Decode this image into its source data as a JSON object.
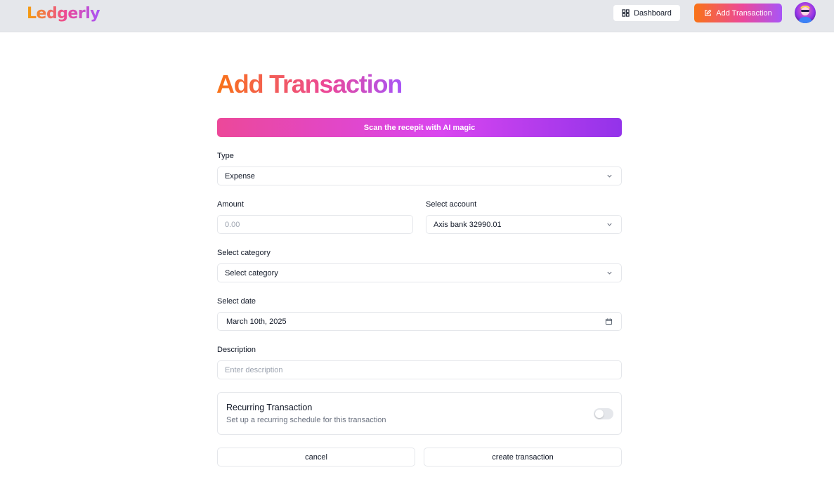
{
  "header": {
    "logo": "Ledgerly",
    "dashboard_label": "Dashboard",
    "add_transaction_label": "Add Transaction"
  },
  "main": {
    "title": "Add Transaction",
    "scan_label": "Scan the recepit with AI magic",
    "type": {
      "label": "Type",
      "value": "Expense"
    },
    "amount": {
      "label": "Amount",
      "placeholder": "0.00"
    },
    "account": {
      "label": "Select account",
      "value": "Axis bank 32990.01"
    },
    "category": {
      "label": "Select category",
      "value": "Select category"
    },
    "date": {
      "label": "Select date",
      "value": "March 10th, 2025"
    },
    "description": {
      "label": "Description",
      "placeholder": "Enter description"
    },
    "recurring": {
      "title": "Recurring Transaction",
      "subtitle": "Set up a recurring schedule for this transaction",
      "enabled": false
    },
    "cancel_label": "cancel",
    "create_label": "create transaction"
  },
  "colors": {
    "accent_orange": "#f97316",
    "accent_pink": "#ec4899",
    "accent_purple": "#a855f7",
    "header_bg": "#e5e7eb"
  },
  "icons": [
    "dashboard-icon",
    "pen-square-icon",
    "chevron-down-icon",
    "calendar-icon",
    "avatar"
  ]
}
